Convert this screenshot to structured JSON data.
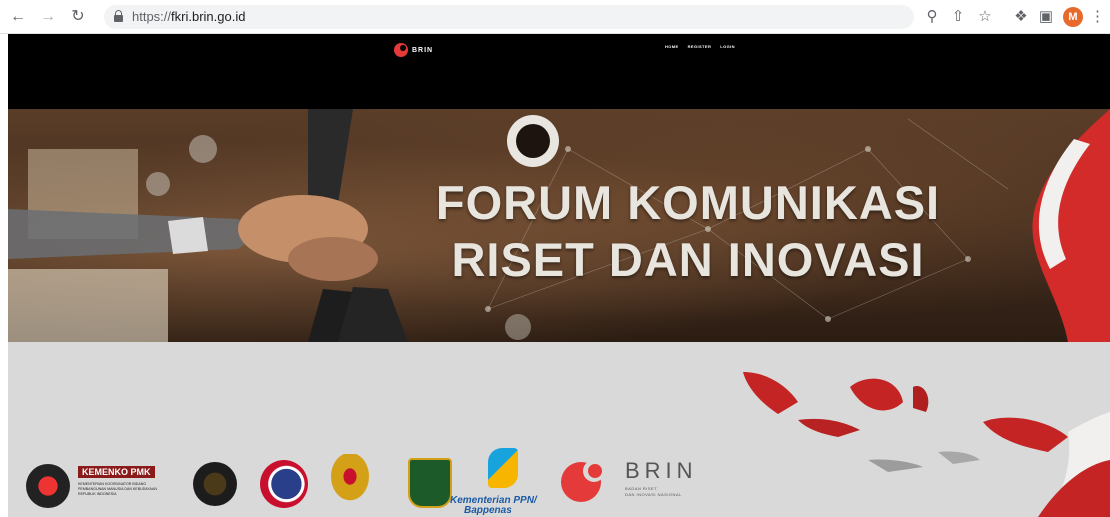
{
  "browser": {
    "url_scheme": "https://",
    "url_host": "fkri.brin.go.id",
    "profile_initial": "M",
    "icons": [
      "back-arrow-icon",
      "forward-arrow-icon",
      "reload-icon",
      "lock-icon",
      "zoom-icon",
      "share-icon",
      "star-icon",
      "extensions-icon",
      "sidepanel-icon",
      "menu-icon"
    ]
  },
  "site": {
    "brand": "BRIN",
    "menu": [
      "HOME",
      "REGISTER",
      "LOGIN"
    ],
    "hero": {
      "line1": "FORUM KOMUNIKASI",
      "line2": "RISET DAN INOVASI"
    },
    "partners": {
      "kemenko_label": "KEMENKO PMK",
      "kemenko_sub": "KEMENTERIAN KOORDINATOR BIDANG PEMBANGUNAN MANUSIA DAN KEBUDAYAAN REPUBLIK INDONESIA",
      "bappenas_line1": "Kementerian PPN/",
      "bappenas_line2": "Bappenas",
      "brin_word": "BRIN",
      "brin_sub_line1": "BADAN RISET",
      "brin_sub_line2": "DAN INOVASI NASIONAL"
    },
    "colors": {
      "brin_red": "#e43a3a",
      "hero_text": "#e8e4de",
      "kemenko_red": "#8b1b1b"
    }
  }
}
